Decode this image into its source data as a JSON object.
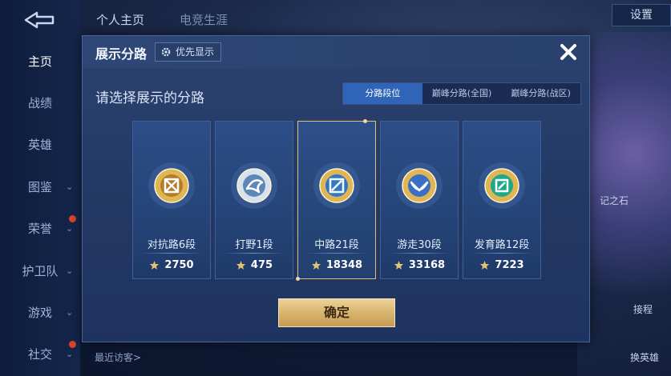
{
  "nav": {
    "items": [
      {
        "label": "主页",
        "active": true,
        "chevron": false,
        "badge": false
      },
      {
        "label": "战绩",
        "active": false,
        "chevron": false,
        "badge": false
      },
      {
        "label": "英雄",
        "active": false,
        "chevron": false,
        "badge": false
      },
      {
        "label": "图鉴",
        "active": false,
        "chevron": true,
        "badge": false
      },
      {
        "label": "荣誉",
        "active": false,
        "chevron": true,
        "badge": true
      },
      {
        "label": "护卫队",
        "active": false,
        "chevron": true,
        "badge": false
      },
      {
        "label": "游戏",
        "active": false,
        "chevron": true,
        "badge": false
      },
      {
        "label": "社交",
        "active": false,
        "chevron": true,
        "badge": true
      }
    ],
    "chevron_glyph": "⌄"
  },
  "top": {
    "tab_personal": "个人主页",
    "tab_esports": "电竞生涯",
    "settings_label": "设置"
  },
  "background": {
    "right_label_1": "记之石",
    "right_label_2": "接程",
    "right_label_3": "换英雄",
    "recent_visitors": "最近访客>"
  },
  "dialog": {
    "title": "展示分路",
    "priority_label": "优先显示",
    "close_glyph": "✕",
    "prompt": "请选择展示的分路",
    "tabs": [
      {
        "label": "分路段位",
        "active": true
      },
      {
        "label": "巅峰分路(全国)",
        "active": false
      },
      {
        "label": "巅峰分路(战区)",
        "active": false
      }
    ],
    "cards": [
      {
        "rank": "对抗路6段",
        "score": "2750",
        "selected": false,
        "emblem_color": "#e0b553",
        "inner_color": "#b57a2a",
        "icon": "clash-lane-emblem-icon"
      },
      {
        "rank": "打野1段",
        "score": "475",
        "selected": false,
        "emblem_color": "#d8e2ee",
        "inner_color": "#5f86b8",
        "icon": "jungle-emblem-icon"
      },
      {
        "rank": "中路21段",
        "score": "18348",
        "selected": true,
        "emblem_color": "#e0b553",
        "inner_color": "#2f78c8",
        "icon": "mid-lane-emblem-icon"
      },
      {
        "rank": "游走30段",
        "score": "33168",
        "selected": false,
        "emblem_color": "#e0b553",
        "inner_color": "#3a6fc4",
        "icon": "roam-emblem-icon"
      },
      {
        "rank": "发育路12段",
        "score": "7223",
        "selected": false,
        "emblem_color": "#e0b553",
        "inner_color": "#1ea88a",
        "icon": "farm-lane-emblem-icon"
      }
    ],
    "confirm_label": "确定"
  },
  "colors": {
    "accent_blue": "#2f64b8",
    "gold": "#e2c07a",
    "score_icon": "#e3c372"
  }
}
